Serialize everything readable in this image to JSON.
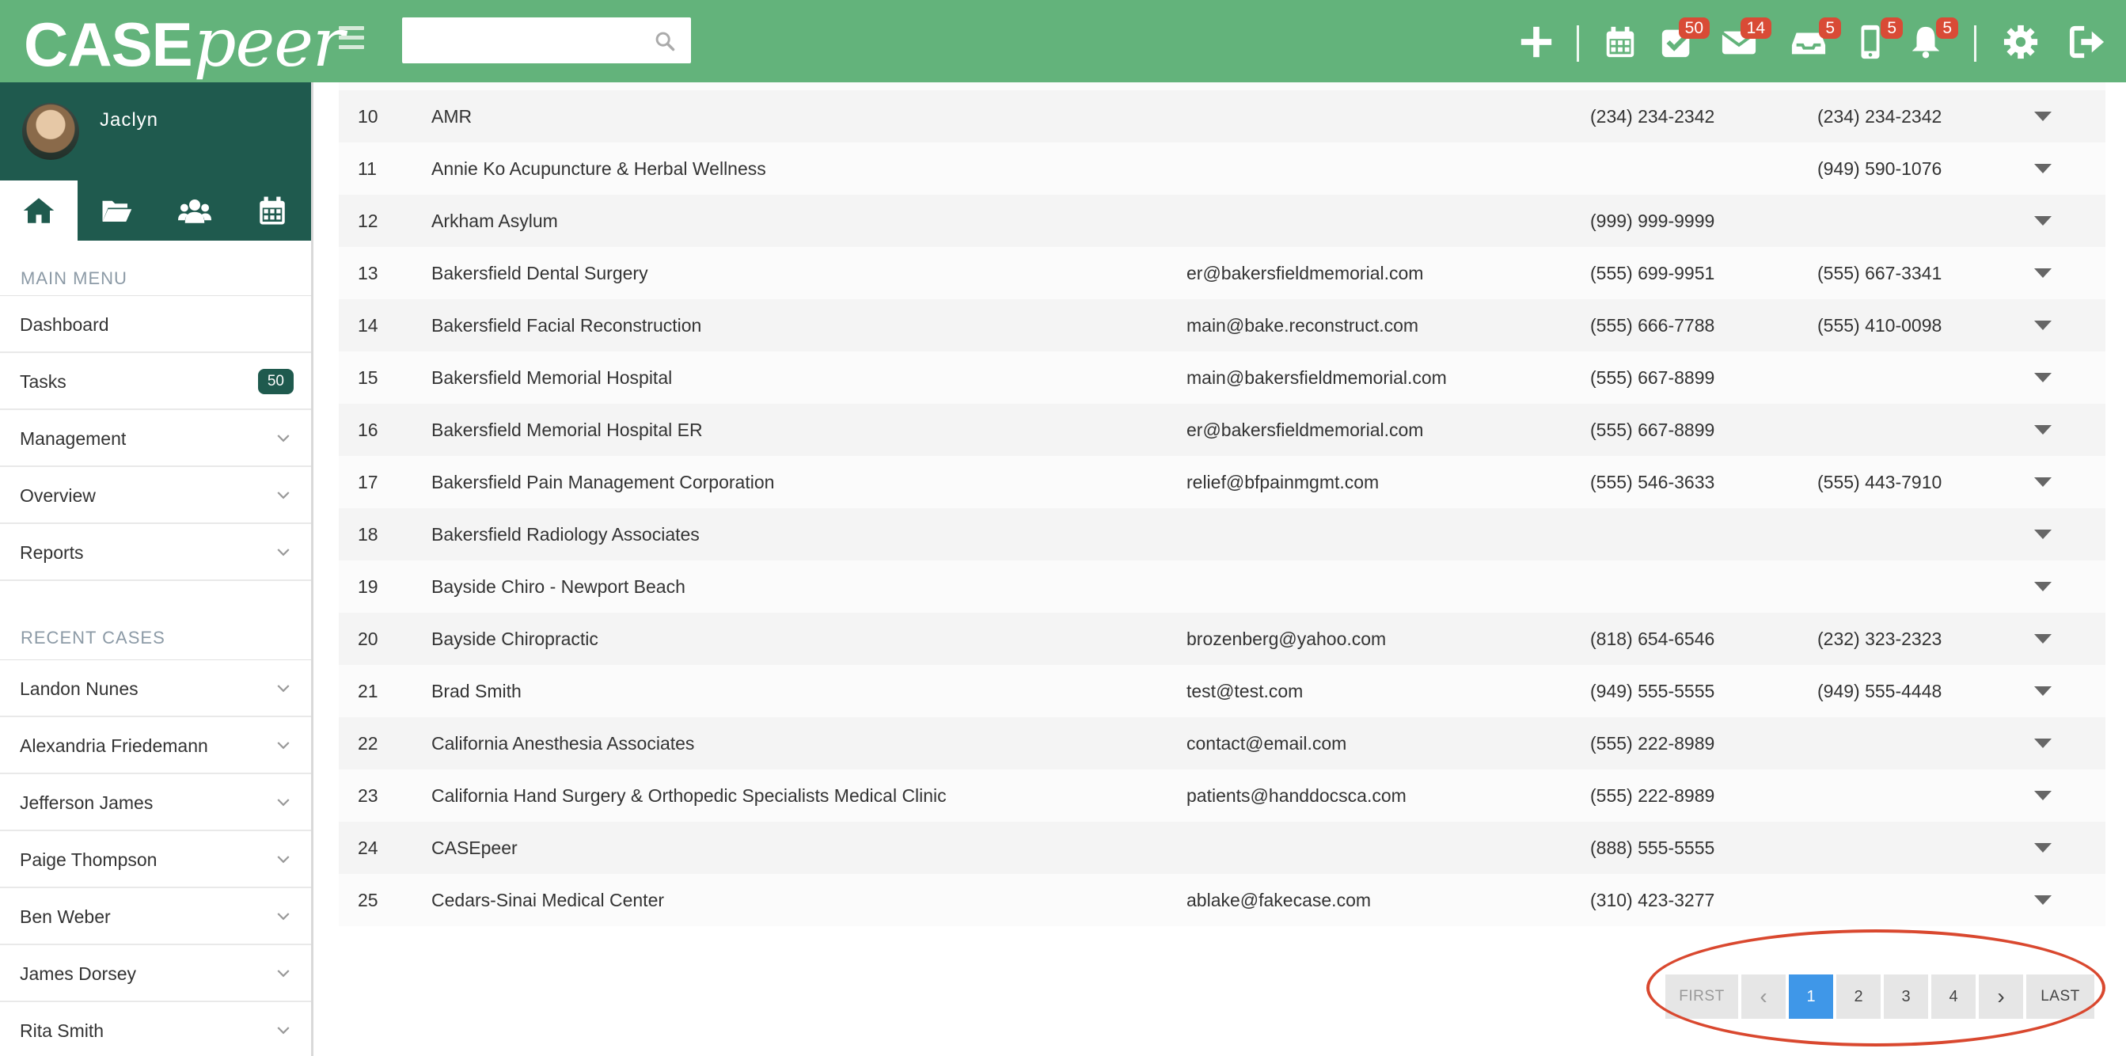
{
  "header": {
    "logo_case": "CASE",
    "logo_peer": "peer",
    "search_placeholder": "",
    "badges": {
      "tasks": "50",
      "mail": "14",
      "inbox": "5",
      "phone": "5",
      "notifications": "5"
    },
    "accent_color": "#63b37b"
  },
  "sidebar": {
    "user_name": "Jaclyn",
    "main_menu_label": "MAIN MENU",
    "main_menu": [
      {
        "label": "Dashboard"
      },
      {
        "label": "Tasks",
        "count": "50"
      },
      {
        "label": "Management"
      },
      {
        "label": "Overview"
      },
      {
        "label": "Reports"
      }
    ],
    "recent_cases_label": "RECENT CASES",
    "recent_cases": [
      {
        "label": "Landon Nunes"
      },
      {
        "label": "Alexandria Friedemann"
      },
      {
        "label": "Jefferson James"
      },
      {
        "label": "Paige Thompson"
      },
      {
        "label": "Ben Weber"
      },
      {
        "label": "James Dorsey"
      },
      {
        "label": "Rita Smith"
      }
    ]
  },
  "table": {
    "rows": [
      {
        "num": "10",
        "name": "AMR",
        "email": "",
        "phone1": "(234) 234-2342",
        "phone2": "(234) 234-2342"
      },
      {
        "num": "11",
        "name": "Annie Ko Acupuncture & Herbal Wellness",
        "email": "",
        "phone1": "",
        "phone2": "(949) 590-1076"
      },
      {
        "num": "12",
        "name": "Arkham Asylum",
        "email": "",
        "phone1": "(999) 999-9999",
        "phone2": ""
      },
      {
        "num": "13",
        "name": "Bakersfield Dental Surgery",
        "email": "er@bakersfieldmemorial.com",
        "phone1": "(555) 699-9951",
        "phone2": "(555) 667-3341"
      },
      {
        "num": "14",
        "name": "Bakersfield Facial Reconstruction",
        "email": "main@bake.reconstruct.com",
        "phone1": "(555) 666-7788",
        "phone2": "(555) 410-0098"
      },
      {
        "num": "15",
        "name": "Bakersfield Memorial Hospital",
        "email": "main@bakersfieldmemorial.com",
        "phone1": "(555) 667-8899",
        "phone2": ""
      },
      {
        "num": "16",
        "name": "Bakersfield Memorial Hospital ER",
        "email": "er@bakersfieldmemorial.com",
        "phone1": "(555) 667-8899",
        "phone2": ""
      },
      {
        "num": "17",
        "name": "Bakersfield Pain Management Corporation",
        "email": "relief@bfpainmgmt.com",
        "phone1": "(555) 546-3633",
        "phone2": "(555) 443-7910"
      },
      {
        "num": "18",
        "name": "Bakersfield Radiology Associates",
        "email": "",
        "phone1": "",
        "phone2": ""
      },
      {
        "num": "19",
        "name": "Bayside Chiro - Newport Beach",
        "email": "",
        "phone1": "",
        "phone2": ""
      },
      {
        "num": "20",
        "name": "Bayside Chiropractic",
        "email": "brozenberg@yahoo.com",
        "phone1": "(818) 654-6546",
        "phone2": "(232) 323-2323"
      },
      {
        "num": "21",
        "name": "Brad Smith",
        "email": "test@test.com",
        "phone1": "(949) 555-5555",
        "phone2": "(949) 555-4448"
      },
      {
        "num": "22",
        "name": "California Anesthesia Associates",
        "email": "contact@email.com",
        "phone1": "(555) 222-8989",
        "phone2": ""
      },
      {
        "num": "23",
        "name": "California Hand Surgery & Orthopedic Specialists Medical Clinic",
        "email": "patients@handdocsca.com",
        "phone1": "(555) 222-8989",
        "phone2": ""
      },
      {
        "num": "24",
        "name": "CASEpeer",
        "email": "",
        "phone1": "(888) 555-5555",
        "phone2": ""
      },
      {
        "num": "25",
        "name": "Cedars-Sinai Medical Center",
        "email": "ablake@fakecase.com",
        "phone1": "(310) 423-3277",
        "phone2": ""
      }
    ]
  },
  "pagination": {
    "first": "FIRST",
    "prev": "‹",
    "pages": [
      "1",
      "2",
      "3",
      "4"
    ],
    "active_page": "1",
    "next": "›",
    "last": "LAST",
    "active_color": "#3f97e8"
  },
  "annotation": {
    "circle_color": "#d9482f"
  }
}
